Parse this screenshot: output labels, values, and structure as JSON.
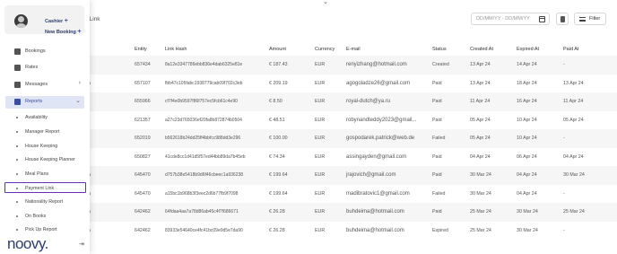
{
  "page": {
    "title_partial": "t Link",
    "date_placeholder": "DD/MM/YY - DD/MM/YY",
    "filter_label": "Filter"
  },
  "sidebar": {
    "role": "Cashier",
    "new_booking": "New Booking",
    "items": [
      {
        "label": "Bookings",
        "icon": "bed-icon"
      },
      {
        "label": "Rates",
        "icon": "dollar-icon"
      },
      {
        "label": "Messages",
        "icon": "chat-icon"
      },
      {
        "label": "Reports",
        "icon": "chart-icon"
      }
    ],
    "sub_items": [
      "Availability",
      "Manager Report",
      "House Keeping",
      "House Keeping Planner",
      "Meal Plans",
      "Payment Link",
      "Nationality Report",
      "On Books",
      "Pick Up Report"
    ],
    "brand": "noovy."
  },
  "table": {
    "headers": [
      "Entity",
      "Link Hash",
      "Amount",
      "Currency",
      "E-mail",
      "Status",
      "Created At",
      "Expired At",
      "Paid At"
    ],
    "rows": [
      {
        "id": "t",
        "entity": "657434",
        "hash": "8a12e3347786ebb836e4dab6325e81e",
        "amount": "€ 187.43",
        "currency": "EUR",
        "email": "renyizhang@hotmail.com",
        "status": "Created",
        "created": "13 Apr 24",
        "expired": "14 Apr 24",
        "paid": "-"
      },
      {
        "id": "a",
        "entity": "657107",
        "hash": "fbb47c105fabc1938779cab09f702c3eb",
        "amount": "€ 209.19",
        "currency": "EUR",
        "email": "agogoladze26@gmail.com",
        "status": "Paid",
        "created": "13 Apr 24",
        "expired": "18 Apr 24",
        "paid": "13 Apr 24"
      },
      {
        "id": "",
        "entity": "655966",
        "hash": "cf7f4e0b9597f86f757ec5fcb61c4e90",
        "amount": "€ 8.50",
        "currency": "EUR",
        "email": "royal-dutch@ya.ru",
        "status": "Paid",
        "created": "11 Apr 24",
        "expired": "16 Apr 24",
        "paid": "11 Apr 24"
      },
      {
        "id": "",
        "entity": "621357",
        "hash": "a27c23d765036ef20fa8b872874b0504",
        "amount": "€ 48.51",
        "currency": "EUR",
        "email": "robynandteddy2023@gmail...",
        "status": "Paid",
        "created": "05 Apr 24",
        "expired": "10 Apr 24",
        "paid": "05 Apr 24"
      },
      {
        "id": "",
        "entity": "652019",
        "hash": "b562618b24dd25ff4bbfcc988dd3e296",
        "amount": "€ 100.00",
        "currency": "EUR",
        "email": "gospodarek.patrick@web.de",
        "status": "Failed",
        "created": "05 Apr 24",
        "expired": "10 Apr 24",
        "paid": "-"
      },
      {
        "id": "",
        "entity": "650827",
        "hash": "41cde8cc1d41d5f57ed44bb89da7b45eb",
        "amount": "€ 74.34",
        "currency": "EUR",
        "email": "assingayden@gmail.com",
        "status": "Paid",
        "created": "04 Apr 24",
        "expired": "06 Apr 24",
        "paid": "04 Apr 24"
      },
      {
        "id": "a",
        "entity": "645470",
        "hash": "d757b38e5418b9d6f46cbeec1a936238",
        "amount": "€ 199.64",
        "currency": "EUR",
        "email": "jrajovich@gmail.com",
        "status": "Paid",
        "created": "30 Mar 24",
        "expired": "04 Apr 24",
        "paid": "30 Mar 24"
      },
      {
        "id": "a",
        "entity": "645470",
        "hash": "a15bc1b968b3f3eec2d6b77fb9f7098",
        "amount": "€ 199.64",
        "currency": "EUR",
        "email": "madibratovic1@gmail.com",
        "status": "Failed",
        "created": "30 Mar 24",
        "expired": "04 Apr 24",
        "paid": "-"
      },
      {
        "id": "a",
        "entity": "642462",
        "hash": "64fdaa4aa7a78d86ab45c4f7f686671",
        "amount": "€ 26.28",
        "currency": "EUR",
        "email": "buhdeima@hotmail.com",
        "status": "Paid",
        "created": "25 Mar 24",
        "expired": "30 Mar 24",
        "paid": "25 Mar 24"
      },
      {
        "id": "a",
        "entity": "642462",
        "hash": "83933e54640ce4fc41bc09e0d5e7da90",
        "amount": "€ 26.28",
        "currency": "EUR",
        "email": "buhdeima@hotmail.com",
        "status": "Expired",
        "created": "25 Mar 24",
        "expired": "30 Mar 24",
        "paid": "-"
      }
    ]
  }
}
